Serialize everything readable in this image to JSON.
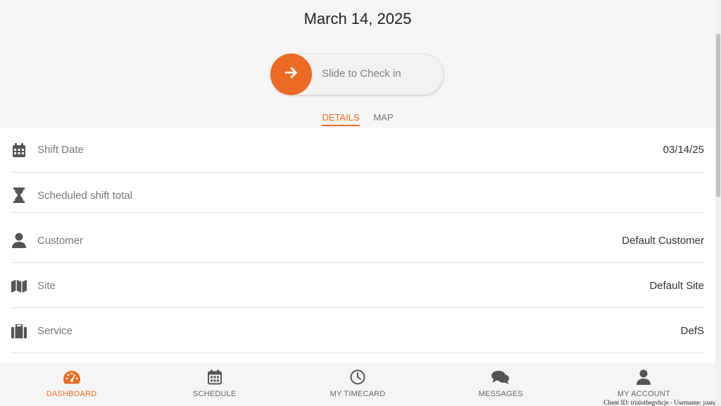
{
  "header": {
    "date": "March 14, 2025"
  },
  "slider": {
    "label": "Slide to Check in",
    "icon": "arrow-right-icon"
  },
  "tabs": [
    {
      "label": "DETAILS",
      "active": true
    },
    {
      "label": "MAP",
      "active": false
    }
  ],
  "details": [
    {
      "label": "Shift Date",
      "value": "03/14/25",
      "icon": "calendar-icon"
    },
    {
      "label": "Scheduled shift total",
      "value": "",
      "icon": "hourglass-icon"
    },
    {
      "label": "Customer",
      "value": "Default Customer",
      "icon": "user-icon"
    },
    {
      "label": "Site",
      "value": "Default Site",
      "icon": "map-icon"
    },
    {
      "label": "Service",
      "value": "DefS",
      "icon": "briefcase-icon"
    }
  ],
  "nav": [
    {
      "label": "DASHBOARD",
      "active": true,
      "icon": "dashboard-icon"
    },
    {
      "label": "SCHEDULE",
      "active": false,
      "icon": "calendar-icon"
    },
    {
      "label": "MY TIMECARD",
      "active": false,
      "icon": "clock-icon"
    },
    {
      "label": "MESSAGES",
      "active": false,
      "icon": "messages-icon"
    },
    {
      "label": "MY ACCOUNT",
      "active": false,
      "icon": "user-icon"
    }
  ],
  "footer": {
    "note": "Client ID: trialothegvhcje - Username: joanaa"
  },
  "colors": {
    "accent": "#ec6a24",
    "icon_gray": "#555555"
  }
}
